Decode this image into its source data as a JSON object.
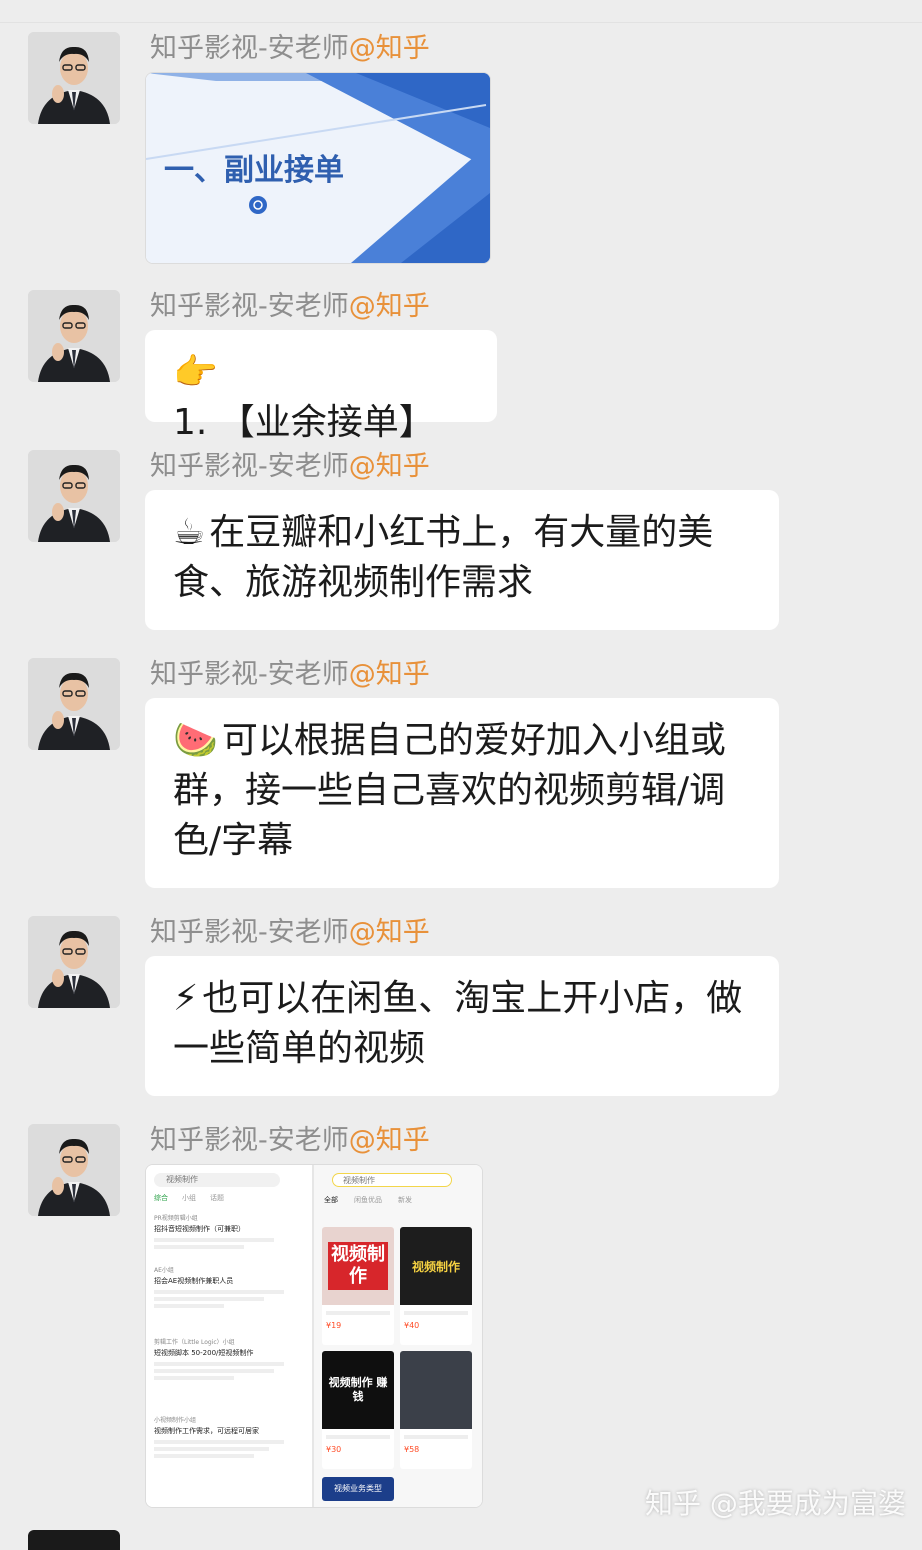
{
  "sender": {
    "name": "知乎影视-安老师",
    "handle": "@知乎"
  },
  "messages": [
    {
      "type": "image",
      "slide_title": "一、副业接单"
    },
    {
      "type": "text",
      "emoji": "👉",
      "text": "1. 【业余接单】"
    },
    {
      "type": "text",
      "emoji": "☕",
      "text": "在豆瓣和小红书上，有大量的美食、旅游视频制作需求"
    },
    {
      "type": "text",
      "emoji": "🍉",
      "text": "可以根据自己的爱好加入小组或群，接一些自己喜欢的视频剪辑/调色/字幕"
    },
    {
      "type": "text",
      "emoji": "⚡",
      "text": "也可以在闲鱼、淘宝上开小店，做一些简单的视频"
    },
    {
      "type": "image",
      "left_panel": {
        "search": "视频制作",
        "tabs": [
          "综合",
          "小组",
          "话题"
        ],
        "posts": [
          {
            "group": "PR视频剪辑小组",
            "title": "招抖音短视频制作（可兼职）"
          },
          {
            "group": "AE小组",
            "title": "招会AE视频制作兼职人员"
          },
          {
            "group": "剪辑工作（Little Logic）小组",
            "title": "短视频脚本 50-200/短视频制作"
          },
          {
            "group": "小视频制作小组",
            "title": "视频制作工作需求，可远程可居家"
          }
        ]
      },
      "right_panel": {
        "search": "视频制作",
        "tabs": [
          "全部",
          "闲鱼优品",
          "新发"
        ],
        "cards": [
          {
            "cover": "视频制作",
            "price": "¥19"
          },
          {
            "cover": "视频制作",
            "price": "¥40"
          },
          {
            "cover": "视频制作 赚钱",
            "price": "¥30"
          },
          {
            "cover": "",
            "price": "¥58"
          }
        ],
        "footer_tag": "视频业务类型"
      }
    }
  ],
  "watermark": "知乎 @我要成为富婆"
}
